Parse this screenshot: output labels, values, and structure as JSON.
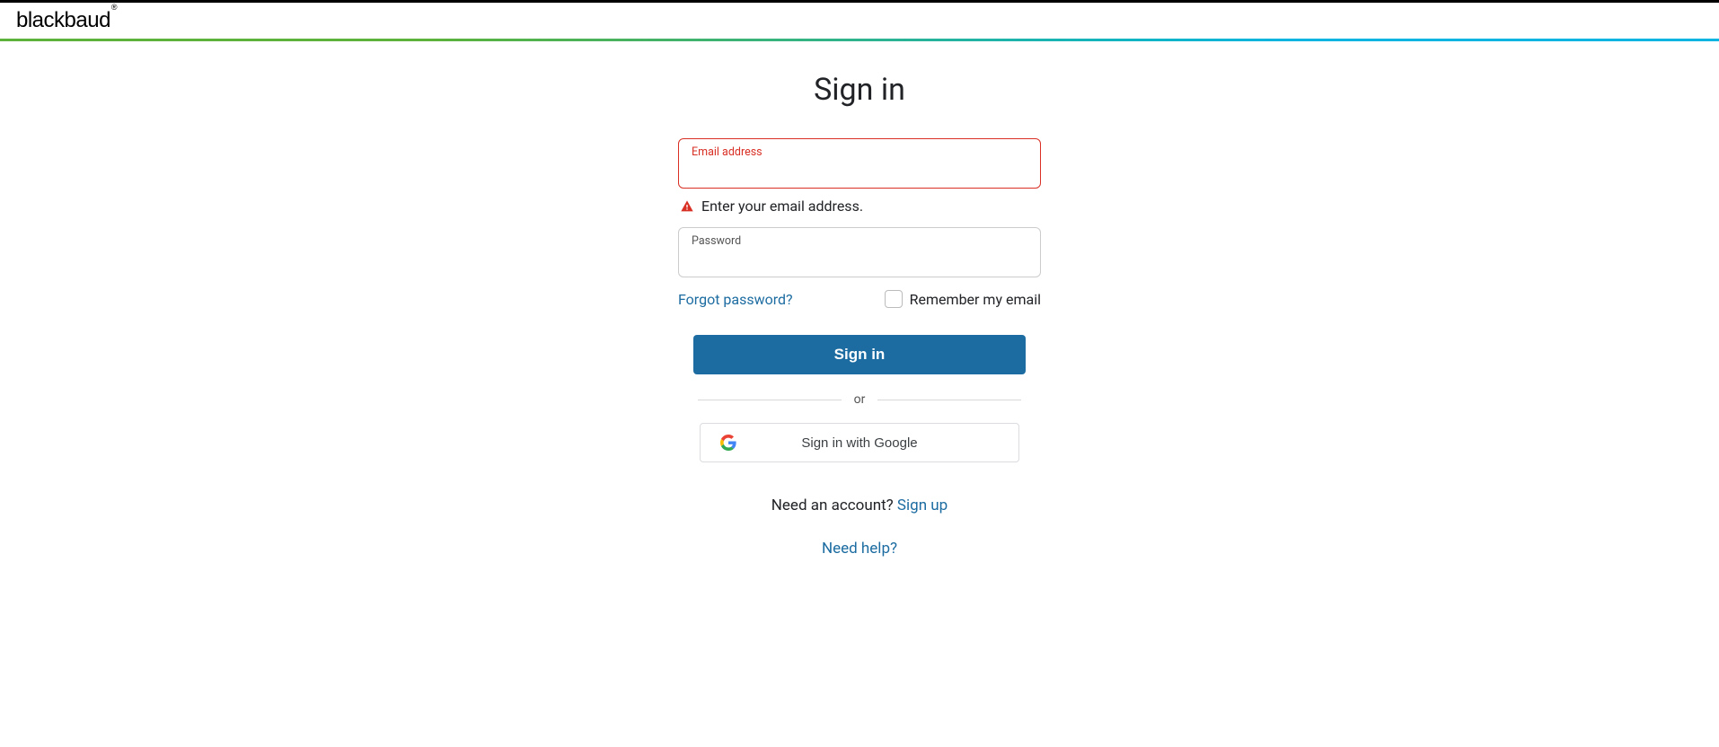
{
  "brand": {
    "name": "blackbaud",
    "reg": "®"
  },
  "page": {
    "title": "Sign in"
  },
  "form": {
    "email": {
      "label": "Email address",
      "value": "",
      "error_message": "Enter your email address."
    },
    "password": {
      "label": "Password",
      "value": ""
    },
    "forgot_label": "Forgot password?",
    "remember_label": "Remember my email",
    "submit_label": "Sign in",
    "divider_label": "or",
    "google_label": "Sign in with Google"
  },
  "footer": {
    "need_account_text": "Need an account? ",
    "signup_label": "Sign up",
    "need_help_label": "Need help?"
  }
}
